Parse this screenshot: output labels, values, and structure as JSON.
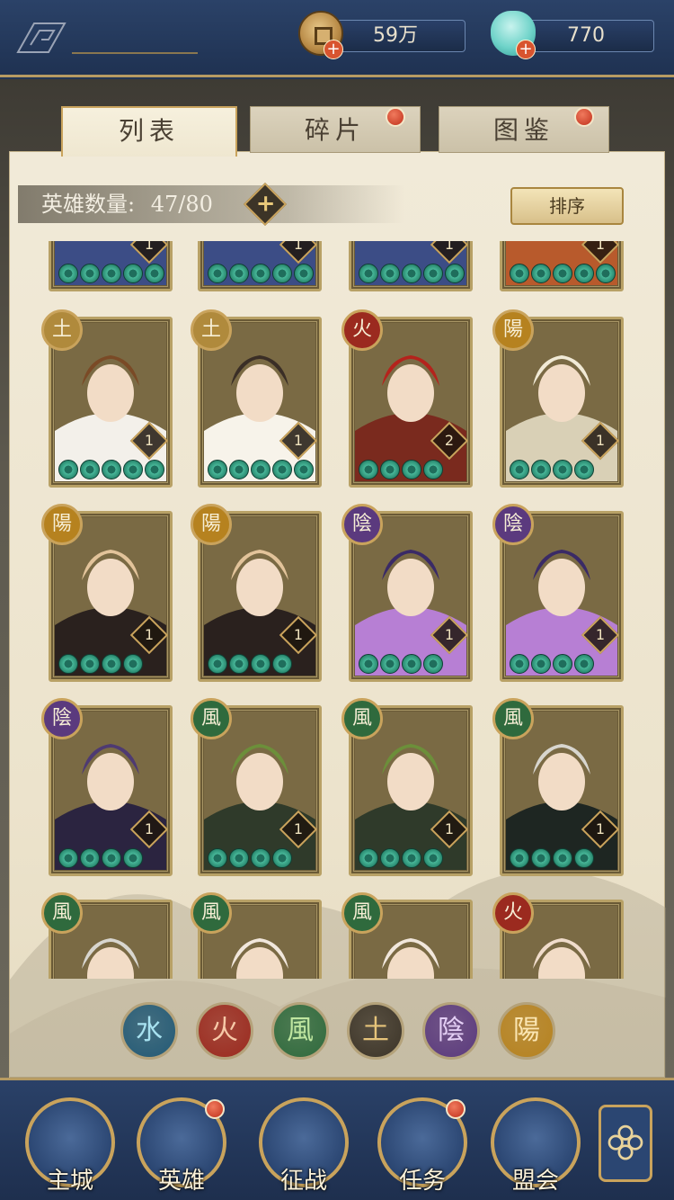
{
  "currency": {
    "coin_value": "59万",
    "jade_value": "770"
  },
  "tabs": [
    {
      "label": "列表",
      "active": true,
      "badge": false
    },
    {
      "label": "碎片",
      "active": false,
      "badge": true
    },
    {
      "label": "图鉴",
      "active": false,
      "badge": true
    }
  ],
  "hero_count": {
    "label": "英雄数量:",
    "value": "47/80"
  },
  "sort_label": "排序",
  "colors": {
    "earth": "#b08a3c",
    "fire": "#9b2a1f",
    "wind": "#2f6a3d",
    "yang": "#b6821f",
    "yin": "#5b3a7e",
    "water": "#235a76"
  },
  "heroes": [
    {
      "element_glyph": "",
      "element": "",
      "level": "1",
      "stars": 5,
      "partial": true,
      "colors": [
        "#3c4d86",
        "#d0a36b"
      ]
    },
    {
      "element_glyph": "",
      "element": "",
      "level": "1",
      "stars": 5,
      "partial": true,
      "colors": [
        "#3c4d86",
        "#c86b3c"
      ]
    },
    {
      "element_glyph": "",
      "element": "",
      "level": "1",
      "stars": 5,
      "partial": true,
      "colors": [
        "#3c4d86",
        "#c86b3c"
      ]
    },
    {
      "element_glyph": "",
      "element": "",
      "level": "1",
      "stars": 5,
      "partial": true,
      "colors": [
        "#b85a2c",
        "#e0a15c"
      ]
    },
    {
      "element_glyph": "土",
      "element": "earth",
      "level": "1",
      "stars": 5,
      "colors": [
        "#f3f0ea",
        "#7a4a26"
      ]
    },
    {
      "element_glyph": "土",
      "element": "earth",
      "level": "1",
      "stars": 5,
      "colors": [
        "#f7f3ea",
        "#3a2e26"
      ]
    },
    {
      "element_glyph": "火",
      "element": "fire",
      "level": "2",
      "stars": 4,
      "colors": [
        "#7a2a1e",
        "#b4231c"
      ]
    },
    {
      "element_glyph": "陽",
      "element": "yang",
      "level": "1",
      "stars": 4,
      "colors": [
        "#d9d0b6",
        "#f1ead6"
      ]
    },
    {
      "element_glyph": "陽",
      "element": "yang",
      "level": "1",
      "stars": 4,
      "colors": [
        "#2a211e",
        "#e2c39a"
      ]
    },
    {
      "element_glyph": "陽",
      "element": "yang",
      "level": "1",
      "stars": 4,
      "colors": [
        "#2a211e",
        "#e2c39a"
      ]
    },
    {
      "element_glyph": "陰",
      "element": "yin",
      "level": "1",
      "stars": 4,
      "colors": [
        "#b77fd4",
        "#3a2a66"
      ]
    },
    {
      "element_glyph": "陰",
      "element": "yin",
      "level": "1",
      "stars": 4,
      "colors": [
        "#b77fd4",
        "#3a2a66"
      ]
    },
    {
      "element_glyph": "陰",
      "element": "yin",
      "level": "1",
      "stars": 4,
      "colors": [
        "#2b2440",
        "#4e3a72"
      ]
    },
    {
      "element_glyph": "風",
      "element": "wind",
      "level": "1",
      "stars": 4,
      "colors": [
        "#2f3a2a",
        "#6c8f3a"
      ]
    },
    {
      "element_glyph": "風",
      "element": "wind",
      "level": "1",
      "stars": 4,
      "colors": [
        "#2f3a2a",
        "#6c8f3a"
      ]
    },
    {
      "element_glyph": "風",
      "element": "wind",
      "level": "1",
      "stars": 4,
      "colors": [
        "#1e2622",
        "#d8d6cf"
      ]
    },
    {
      "element_glyph": "風",
      "element": "wind",
      "level": "",
      "stars": 0,
      "colors": [
        "#1c1e22",
        "#d8d6cf"
      ]
    },
    {
      "element_glyph": "風",
      "element": "wind",
      "level": "",
      "stars": 0,
      "colors": [
        "#1a1e22",
        "#f1e7dc"
      ]
    },
    {
      "element_glyph": "風",
      "element": "wind",
      "level": "",
      "stars": 0,
      "colors": [
        "#1a1e22",
        "#f1e7dc"
      ]
    },
    {
      "element_glyph": "火",
      "element": "fire",
      "level": "",
      "stars": 0,
      "colors": [
        "#1a1a1e",
        "#f0dccb"
      ]
    }
  ],
  "element_filters": [
    {
      "glyph": "水",
      "name": "water",
      "color": "#235a76",
      "text": "#a8e2f0"
    },
    {
      "glyph": "火",
      "name": "fire",
      "color": "#9b2a1f",
      "text": "#f7c9a8"
    },
    {
      "glyph": "風",
      "name": "wind",
      "color": "#2f6a3d",
      "text": "#bfe6a0"
    },
    {
      "glyph": "土",
      "name": "earth",
      "color": "#3c3428",
      "text": "#e6c47a"
    },
    {
      "glyph": "陰",
      "name": "yin",
      "color": "#5b3a7e",
      "text": "#e4cff5"
    },
    {
      "glyph": "陽",
      "name": "yang",
      "color": "#b6821f",
      "text": "#fbe6b3"
    }
  ],
  "nav": [
    {
      "label": "主城",
      "icon": "palace-icon",
      "badge": false
    },
    {
      "label": "英雄",
      "icon": "hero-icon",
      "badge": true
    },
    {
      "label": "征战",
      "icon": "conquest-icon",
      "badge": false
    },
    {
      "label": "任务",
      "icon": "scroll-icon",
      "badge": true
    },
    {
      "label": "盟会",
      "icon": "pavilion-icon",
      "badge": false
    }
  ]
}
